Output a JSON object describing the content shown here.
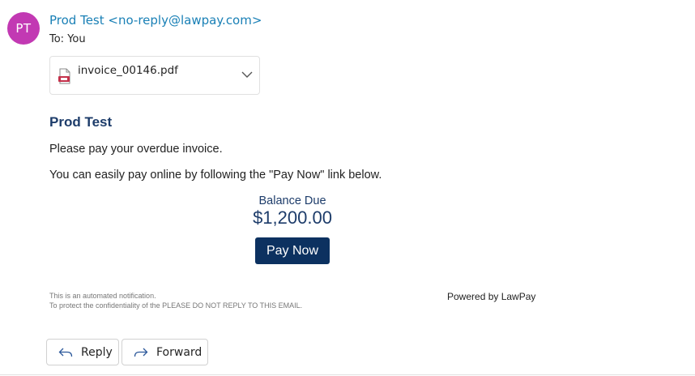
{
  "sender": {
    "initials": "PT",
    "display": "Prod Test <no-reply@lawpay.com>",
    "to_label": "To:",
    "to_value": "You"
  },
  "attachment": {
    "filename": "invoice_00146.pdf",
    "icon": "pdf-file-icon"
  },
  "body": {
    "title": "Prod Test",
    "paragraph1": "Please pay your overdue invoice.",
    "paragraph2": "You can easily pay online by following the \"Pay Now\" link below.",
    "balance_label": "Balance Due",
    "balance_amount": "$1,200.00",
    "pay_button": "Pay Now",
    "footer_line1": "This is an automated notification.",
    "footer_line2": "To protect the confidentiality of the PLEASE DO NOT REPLY TO THIS EMAIL.",
    "powered_by": "Powered by LawPay"
  },
  "actions": {
    "reply": "Reply",
    "forward": "Forward"
  },
  "colors": {
    "avatar": "#c239b3",
    "sender_link": "#1a80b6",
    "brand_navy": "#0c3160",
    "title_navy": "#1d3c6a"
  }
}
